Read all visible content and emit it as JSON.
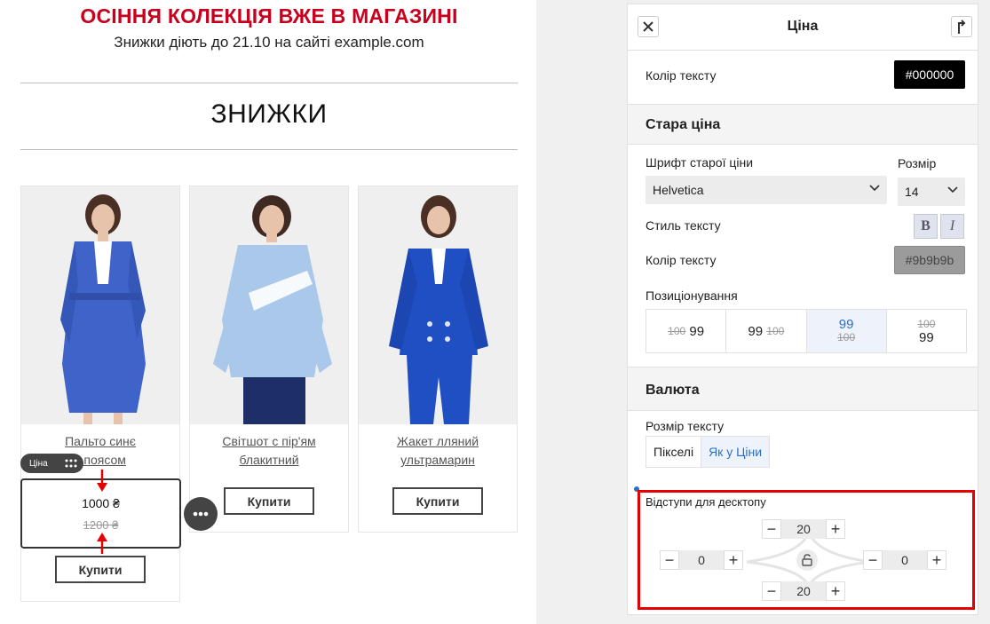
{
  "canvas": {
    "promo_title": "ОСІННЯ КОЛЕКЦІЯ ВЖЕ В МАГАЗИНІ",
    "promo_subtitle": "Знижки діють до 21.10 на сайті example.com",
    "section_title": "ЗНИЖКИ",
    "products": [
      {
        "name_line1": "Пальто синє",
        "name_line2": "з поясом",
        "buy_label": "Купити",
        "price": "1000 ₴",
        "old_price": "1200 ₴"
      },
      {
        "name_line1": "Світшот с пір'ям",
        "name_line2": "блакитний",
        "buy_label": "Купити"
      },
      {
        "name_line1": "Жакет лляний",
        "name_line2": "ультрамарин",
        "buy_label": "Купити"
      }
    ],
    "price_tag_label": "Ціна"
  },
  "panel": {
    "title": "Ціна",
    "text_color_label": "Колір тексту",
    "text_color_value": "#000000",
    "old_price_section": "Стара ціна",
    "old_font_label": "Шрифт старої ціни",
    "old_font_value": "Helvetica",
    "size_label": "Розмір",
    "size_value": "14",
    "text_style_label": "Стиль тексту",
    "bold_label": "B",
    "italic_label": "I",
    "old_color_label": "Колір тексту",
    "old_color_value": "#9b9b9b",
    "positioning_label": "Позиціонування",
    "positions": [
      {
        "old": "100",
        "new": "99"
      },
      {
        "new": "99",
        "old": "100"
      },
      {
        "new": "99",
        "old": "100"
      },
      {
        "old": "100",
        "new": "99"
      }
    ],
    "currency_section": "Валюта",
    "text_size_label": "Розмір тексту",
    "text_size_options": [
      "Пікселі",
      "Як у Ціни"
    ],
    "text_size_selected": "Як у Ціни",
    "desktop_spacing_label": "Відступи для десктопу",
    "spacing": {
      "top": "20",
      "left": "0",
      "right": "0",
      "bottom": "20"
    }
  },
  "colors": {
    "promo_red": "#c8001e",
    "highlight_red": "#e50000",
    "accent_blue": "#2b6fc5",
    "old_price_grey": "#9b9b9b"
  }
}
